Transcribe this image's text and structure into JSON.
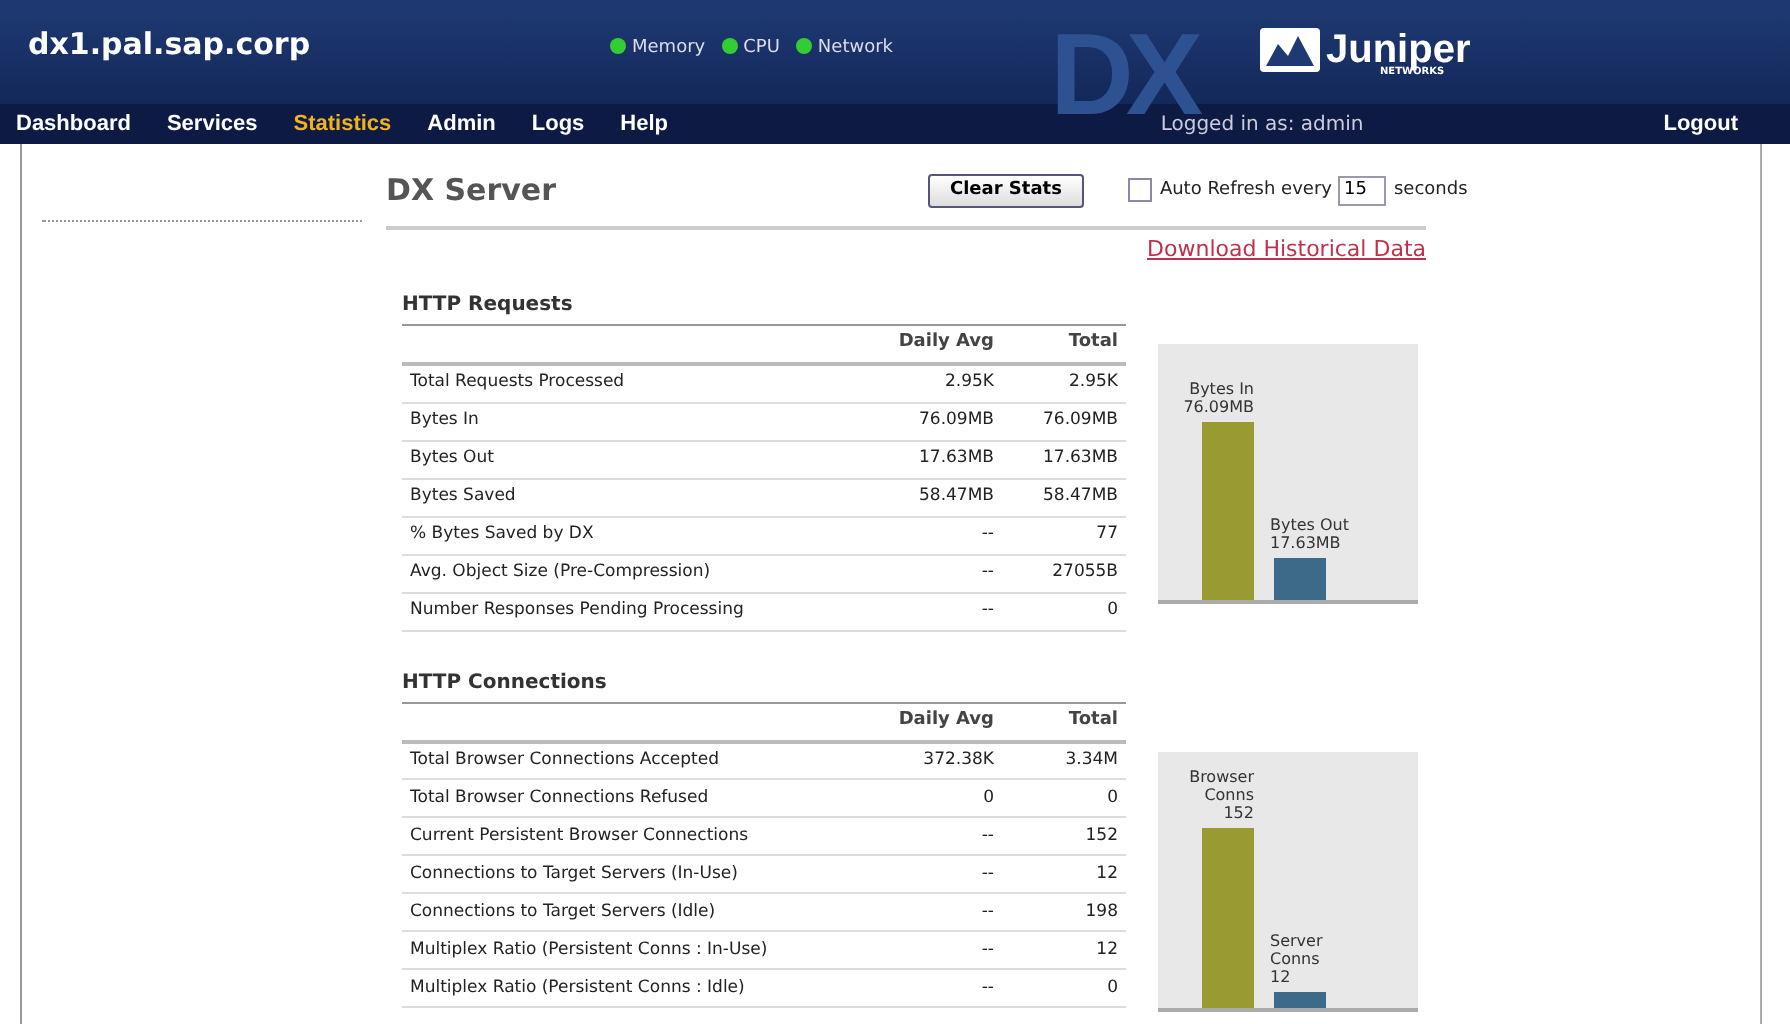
{
  "header": {
    "host": "dx1.pal.sap.corp",
    "indicators": [
      {
        "label": "Memory",
        "color": "#33cc33"
      },
      {
        "label": "CPU",
        "color": "#33cc33"
      },
      {
        "label": "Network",
        "color": "#33cc33"
      }
    ],
    "product_mark": "DX",
    "brand": "Juniper",
    "brand_sub": "NETWORKS"
  },
  "nav": {
    "items": [
      {
        "label": "Dashboard",
        "selected": false
      },
      {
        "label": "Services",
        "selected": false
      },
      {
        "label": "Statistics",
        "selected": true
      },
      {
        "label": "Admin",
        "selected": false
      },
      {
        "label": "Logs",
        "selected": false
      },
      {
        "label": "Help",
        "selected": false
      }
    ],
    "user": "Logged in as: admin",
    "logout": "Logout"
  },
  "page": {
    "title": "DX Server",
    "clear_button": "Clear Stats",
    "auto_refresh": {
      "label": "Auto Refresh every",
      "checked": false,
      "value": "15",
      "unit": "seconds"
    },
    "download_link": "Download Historical Data"
  },
  "sections": [
    {
      "title": "HTTP Requests",
      "columns": [
        "",
        "Daily Avg",
        "Total"
      ],
      "rows": [
        [
          "Total Requests Processed",
          "2.95K",
          "2.95K"
        ],
        [
          "Bytes In",
          "76.09MB",
          "76.09MB"
        ],
        [
          "Bytes Out",
          "17.63MB",
          "17.63MB"
        ],
        [
          "Bytes Saved",
          "58.47MB",
          "58.47MB"
        ],
        [
          "% Bytes Saved by DX",
          "--",
          "77"
        ],
        [
          "Avg. Object Size (Pre-Compression)",
          "--",
          "27055B"
        ],
        [
          "Number Responses Pending Processing",
          "--",
          "0"
        ]
      ],
      "bars": [
        {
          "label": "Bytes In",
          "value": "76.09MB",
          "color": "#9a9a33"
        },
        {
          "label": "Bytes Out",
          "value": "17.63MB",
          "color": "#3e6a8a"
        }
      ]
    },
    {
      "title": "HTTP Connections",
      "columns": [
        "",
        "Daily Avg",
        "Total"
      ],
      "rows": [
        [
          "Total Browser Connections Accepted",
          "372.38K",
          "3.34M"
        ],
        [
          "Total Browser Connections Refused",
          "0",
          "0"
        ],
        [
          "Current Persistent Browser Connections",
          "--",
          "152"
        ],
        [
          "Connections to Target Servers (In-Use)",
          "--",
          "12"
        ],
        [
          "Connections to Target Servers (Idle)",
          "--",
          "198"
        ],
        [
          "Multiplex Ratio (Persistent Conns : In-Use)",
          "--",
          "12"
        ],
        [
          "Multiplex Ratio (Persistent Conns : Idle)",
          "--",
          "0"
        ]
      ],
      "bars": [
        {
          "label": "Browser Conns",
          "value": "152",
          "color": "#9a9a33"
        },
        {
          "label": "Server Conns",
          "value": "12",
          "color": "#3e6a8a"
        }
      ]
    }
  ]
}
